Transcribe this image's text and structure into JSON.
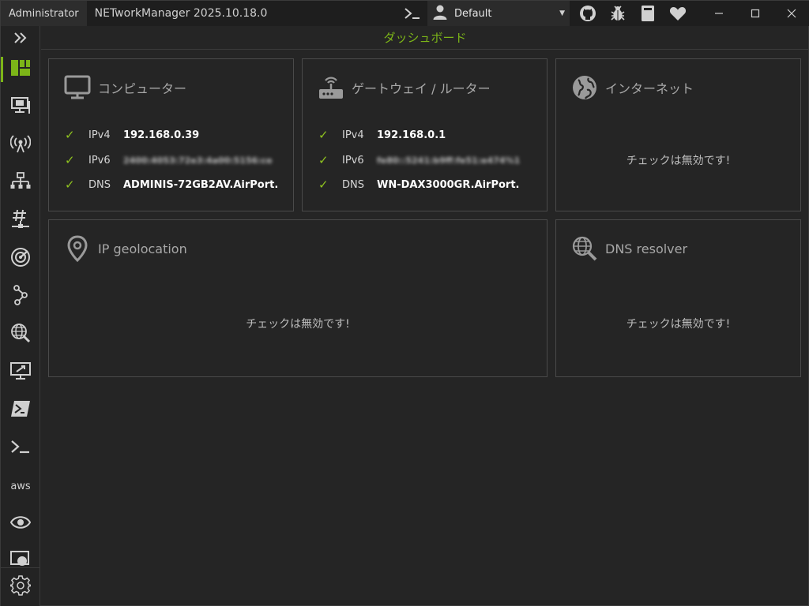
{
  "titlebar": {
    "admin_label": "Administrator",
    "app_title": "NETworkManager 2025.10.18.0",
    "profile": {
      "selected": "Default"
    },
    "icons": [
      "terminal-icon",
      "user-icon",
      "github-icon",
      "bug-icon",
      "book-icon",
      "heart-icon"
    ],
    "window_buttons": [
      "minimize",
      "maximize",
      "close"
    ]
  },
  "sidebar": {
    "expand_icon": "chevrons-right-icon",
    "items": [
      {
        "name": "dashboard",
        "icon": "dashboard-icon",
        "active": true
      },
      {
        "name": "network-interface",
        "icon": "network-interface-icon"
      },
      {
        "name": "wifi",
        "icon": "antenna-icon"
      },
      {
        "name": "ip-scanner",
        "icon": "network-scan-icon"
      },
      {
        "name": "subnet-calculator",
        "icon": "hash-network-icon"
      },
      {
        "name": "port-scanner",
        "icon": "radar-icon"
      },
      {
        "name": "traceroute",
        "icon": "route-icon"
      },
      {
        "name": "dns-lookup",
        "icon": "globe-search-icon"
      },
      {
        "name": "remote-desktop",
        "icon": "remote-desktop-icon"
      },
      {
        "name": "powershell",
        "icon": "powershell-icon"
      },
      {
        "name": "putty",
        "icon": "terminal-icon"
      },
      {
        "name": "aws",
        "icon": "aws-icon",
        "text": "aws"
      },
      {
        "name": "web-console",
        "icon": "eye-icon"
      },
      {
        "name": "snmp",
        "icon": "monitor-globe-icon"
      }
    ],
    "settings_icon": "gear-icon"
  },
  "header": {
    "title": "ダッシュボード"
  },
  "cards": {
    "computer": {
      "title": "コンピューター",
      "icon": "monitor-icon",
      "rows": [
        {
          "key": "IPv4",
          "value": "192.168.0.39"
        },
        {
          "key": "IPv6",
          "value": "2400:4053:72e3:4a00:5156:ce"
        },
        {
          "key": "DNS",
          "value": "ADMINIS-72GB2AV.AirPort."
        }
      ]
    },
    "gateway": {
      "title": "ゲートウェイ / ルーター",
      "icon": "router-icon",
      "rows": [
        {
          "key": "IPv4",
          "value": "192.168.0.1"
        },
        {
          "key": "IPv6",
          "value": "fe80::5241:b9ff:fe51:e474%1"
        },
        {
          "key": "DNS",
          "value": "WN-DAX3000GR.AirPort."
        }
      ]
    },
    "internet": {
      "title": "インターネット",
      "icon": "globe-icon",
      "message": "チェックは無効です!"
    },
    "geolocation": {
      "title": "IP geolocation",
      "icon": "map-pin-icon",
      "message": "チェックは無効です!"
    },
    "dns_resolver": {
      "title": "DNS resolver",
      "icon": "globe-search-icon",
      "message": "チェックは無効です!"
    }
  },
  "colors": {
    "accent": "#7cb518",
    "check": "#8fc31f",
    "background": "#252525",
    "border": "#4a4a4a"
  }
}
